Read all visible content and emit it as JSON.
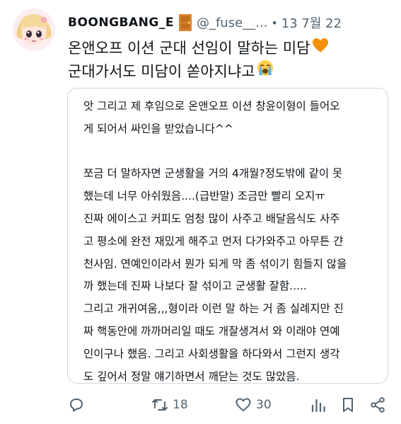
{
  "tweet": {
    "display_name": "BOONGBANG_E",
    "handle": "@_fuse__...",
    "separator": "•",
    "timestamp": "13 7월 22",
    "text_lines": [
      "온앤오프 이션 군대 선임이 말하는 미담",
      "군대가서도 미담이 쏟아지냐고"
    ],
    "emojis": [
      "orange-heart",
      "loudly-crying-face"
    ],
    "author_icon": "door-icon"
  },
  "card": {
    "lines": [
      "앗 그리고 제 후임으로 온앤오프 이션 창윤이형이 들어오",
      "게 되어서 싸인을 받았습니다^^",
      "",
      "",
      "쪼금 더 말하자면 군생활을 거의 4개월?정도밖에 같이 못",
      "했는데 너무 아쉬웠음....(급반말) 조금만 빨리 오지ㅠ",
      "진짜 에이스고 커피도 엄청 많이 사주고 배달음식도 사주",
      "고 평소에 완전 재밌게 해주고 먼저 다가와주고 아무튼 갼",
      "천사임. 연예인이라서 뭔가 되게 막 좀 섞이기 힘들지 않을",
      "까 했는데 진짜 나보다 잘 섞이고 군생활 잘함.....",
      "그리고 개귀여움,,,형이라 이런 말 하는 거 좀 실례지만 진",
      "짜 핵동안에 까까머리일 때도 개잘생겨서 와 이래야 연예",
      "인이구나 했음. 그리고 사회생활을 하다와서 그런지 생각",
      "도 깊어서 정말 얘기하면서 깨닫는 것도 많았음."
    ]
  },
  "actions": {
    "reply_icon": "reply-icon",
    "retweet_count": "18",
    "like_count": "30",
    "icons": [
      "reply-icon",
      "retweet-icon",
      "like-icon",
      "views-icon",
      "bookmark-icon",
      "share-icon"
    ]
  },
  "colors": {
    "text": "#0f1419",
    "secondary": "#536471",
    "border": "#cfd9de",
    "heart": "#f4900c",
    "door": "#d9822b"
  }
}
